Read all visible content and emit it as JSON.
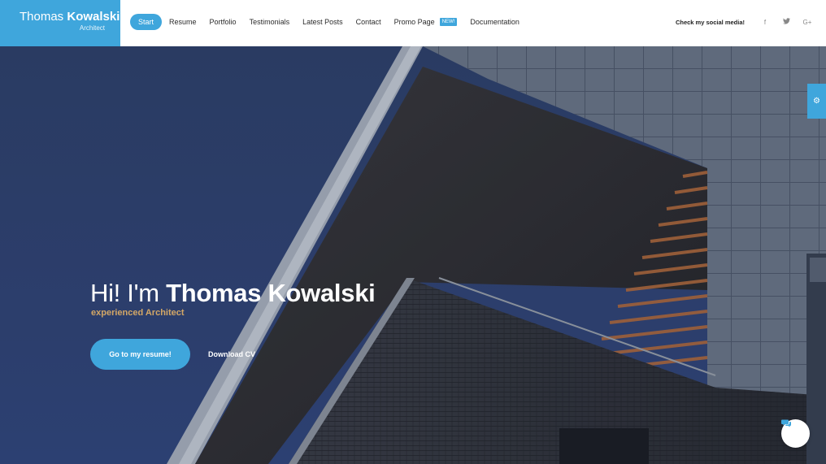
{
  "brand": {
    "first_name": "Thomas",
    "last_name": "Kowalski",
    "subtitle": "Architect"
  },
  "nav": {
    "items": [
      {
        "label": "Start",
        "active": true
      },
      {
        "label": "Resume"
      },
      {
        "label": "Portfolio"
      },
      {
        "label": "Testimonials"
      },
      {
        "label": "Latest Posts"
      },
      {
        "label": "Contact"
      },
      {
        "label": "Promo Page",
        "badge": "NEW!"
      },
      {
        "label": "Documentation"
      }
    ]
  },
  "social": {
    "label": "Check my social media!",
    "icons": [
      {
        "name": "facebook-icon",
        "glyph": "f"
      },
      {
        "name": "twitter-icon",
        "glyph": "🐦"
      },
      {
        "name": "google-plus-icon",
        "glyph": "G+"
      }
    ]
  },
  "hero": {
    "greeting": "Hi! I'm",
    "name": "Thomas Kowalski",
    "subtitle": "experienced Architect",
    "primary_button": "Go to my resume!",
    "secondary_button": "Download CV"
  },
  "icons": {
    "settings": "gear-icon",
    "chat": "chat-icon"
  },
  "colors": {
    "accent": "#3fa6dc",
    "subtitle_gold": "#d3a766",
    "sky": "#2d3f63"
  }
}
